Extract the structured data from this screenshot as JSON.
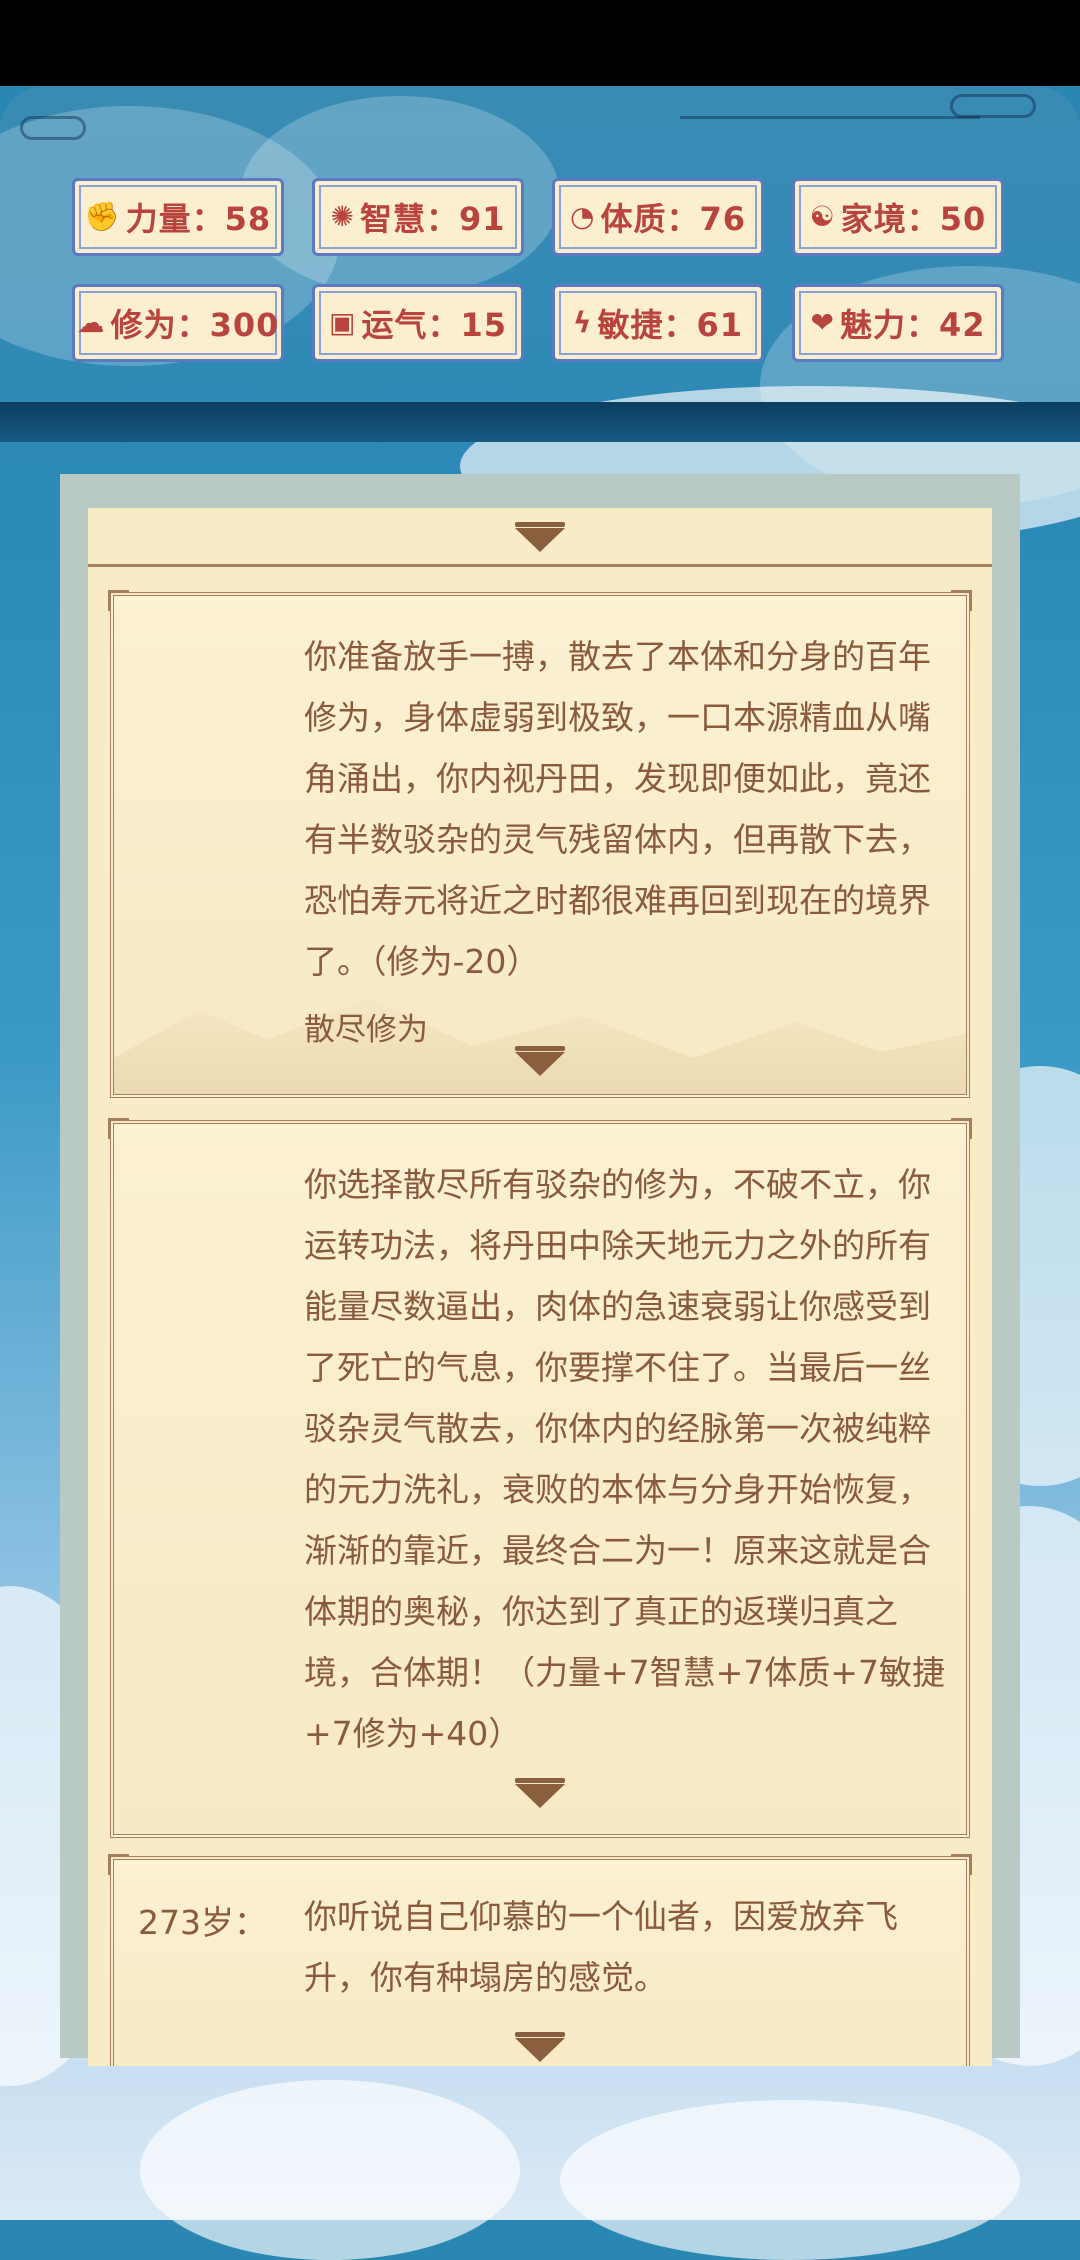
{
  "stats": [
    {
      "icon": "strength-icon",
      "glyph": "✊",
      "label": "力量：58"
    },
    {
      "icon": "wisdom-icon",
      "glyph": "✺",
      "label": "智慧：91"
    },
    {
      "icon": "constitution-icon",
      "glyph": "◔",
      "label": "体质：76"
    },
    {
      "icon": "family-icon",
      "glyph": "☯",
      "label": "家境：50"
    },
    {
      "icon": "cultivation-icon",
      "glyph": "☁",
      "label": "修为：300"
    },
    {
      "icon": "luck-icon",
      "glyph": "▣",
      "label": "运气：15"
    },
    {
      "icon": "agility-icon",
      "glyph": "ϟ",
      "label": "敏捷：61"
    },
    {
      "icon": "charm-icon",
      "glyph": "❤",
      "label": "魅力：42"
    }
  ],
  "events": [
    {
      "age": "",
      "text": "你准备放手一搏，散去了本体和分身的百年修为，身体虚弱到极致，一口本源精血从嘴角涌出，你内视丹田，发现即便如此，竟还有半数驳杂的灵气残留体内，但再散下去，恐怕寿元将近之时都很难再回到现在的境界了。（修为-20）",
      "choice": "散尽修为"
    },
    {
      "age": "",
      "text": "你选择散尽所有驳杂的修为，不破不立，你运转功法，将丹田中除天地元力之外的所有能量尽数逼出，肉体的急速衰弱让你感受到了死亡的气息，你要撑不住了。当最后一丝驳杂灵气散去，你体内的经脉第一次被纯粹的元力洗礼，衰败的本体与分身开始恢复，渐渐的靠近，最终合二为一！原来这就是合体期的奥秘，你达到了真正的返璞归真之境，合体期！（力量+7智慧+7体质+7敏捷+7修为+40）",
      "choice": ""
    },
    {
      "age": "273岁：",
      "text": "你听说自己仰慕的一个仙者，因爱放弃飞升，你有种塌房的感觉。",
      "choice": ""
    }
  ]
}
